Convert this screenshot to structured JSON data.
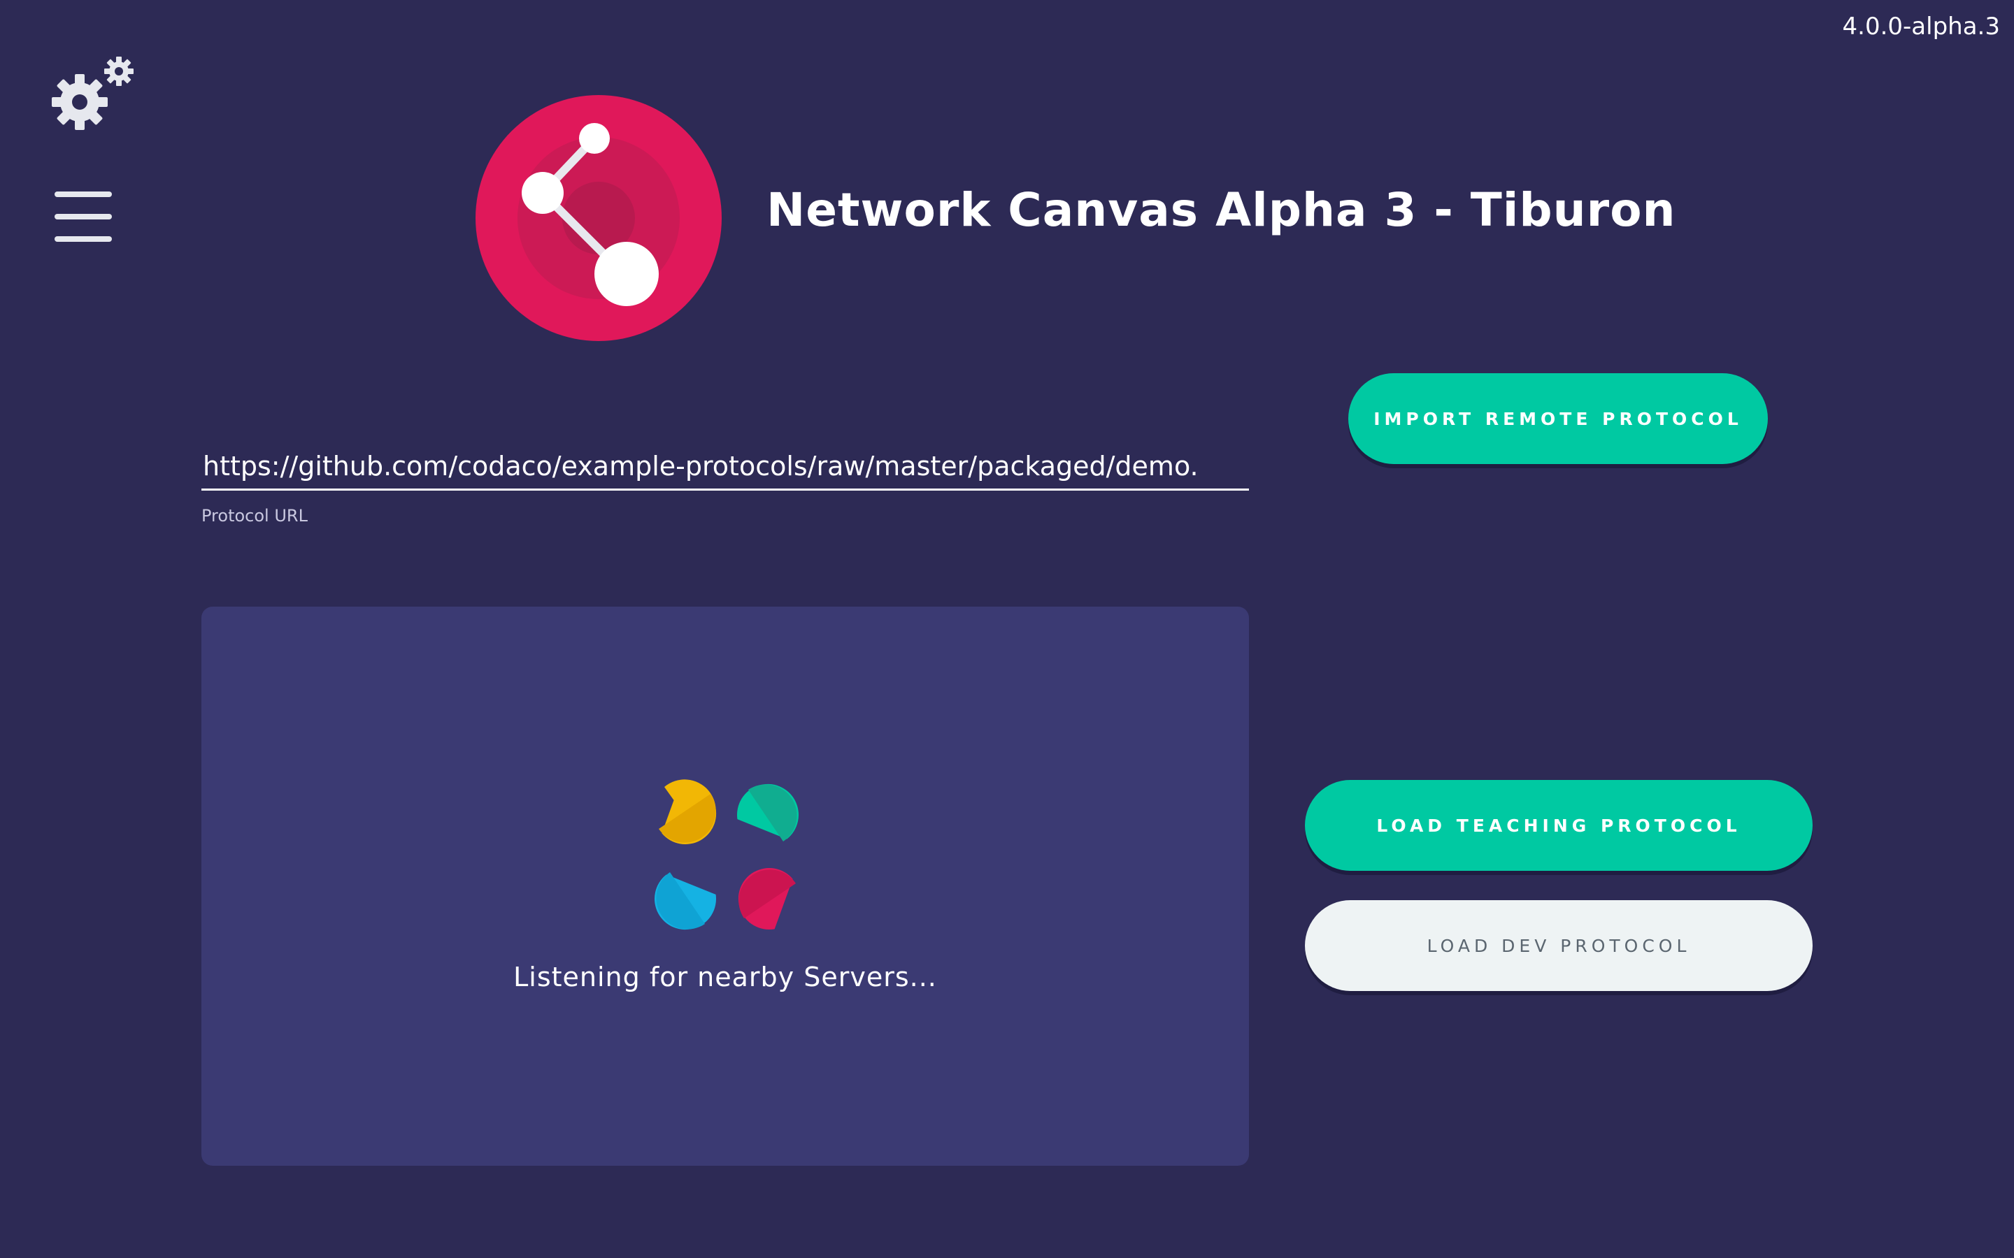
{
  "version": "4.0.0-alpha.3",
  "header": {
    "title": "Network Canvas Alpha 3 - Tiburon"
  },
  "icons": {
    "settings": "gears-icon",
    "menu": "hamburger-menu-icon",
    "logo": "network-canvas-logo",
    "spinner": "server-search-spinner-icon"
  },
  "protocol_url": {
    "value": "https://github.com/codaco/example-protocols/raw/master/packaged/demo.",
    "label": "Protocol URL"
  },
  "buttons": {
    "import_remote": "Import remote protocol",
    "load_teaching": "Load teaching protocol",
    "load_dev": "Load dev protocol"
  },
  "server_discovery": {
    "status": "Listening for nearby Servers..."
  },
  "colors": {
    "background": "#2d2a55",
    "panel": "#3b3a73",
    "primary_button": "#00c9a2",
    "secondary_button": "#eef3f4",
    "logo": "#e0185a"
  }
}
